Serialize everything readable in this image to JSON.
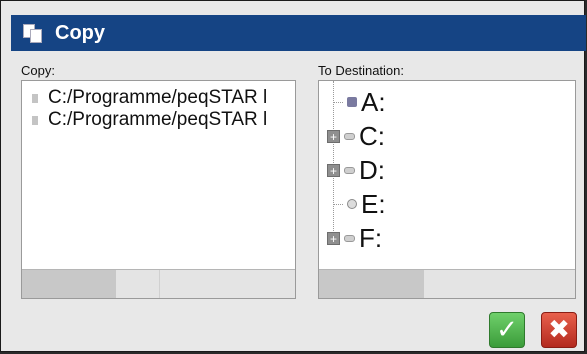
{
  "dialog": {
    "title": "Copy",
    "title_icon": "copy-icon",
    "accent_color": "#154484"
  },
  "source": {
    "label": "Copy:",
    "items": [
      {
        "label": "C:/Programme/peqSTAR l"
      },
      {
        "label": "C:/Programme/peqSTAR l"
      }
    ]
  },
  "destination": {
    "label": "To Destination:",
    "drives": [
      {
        "label": "A:",
        "expandable": false,
        "icon": "floppy-drive-icon"
      },
      {
        "label": "C:",
        "expandable": true,
        "icon": "hard-drive-icon"
      },
      {
        "label": "D:",
        "expandable": true,
        "icon": "hard-drive-icon"
      },
      {
        "label": "E:",
        "expandable": false,
        "icon": "cd-drive-icon"
      },
      {
        "label": "F:",
        "expandable": true,
        "icon": "hard-drive-icon"
      }
    ]
  },
  "buttons": {
    "ok_icon": "checkmark-icon",
    "cancel_icon": "x-icon",
    "ok_color": "#4fb34c",
    "cancel_color": "#d0402f"
  }
}
